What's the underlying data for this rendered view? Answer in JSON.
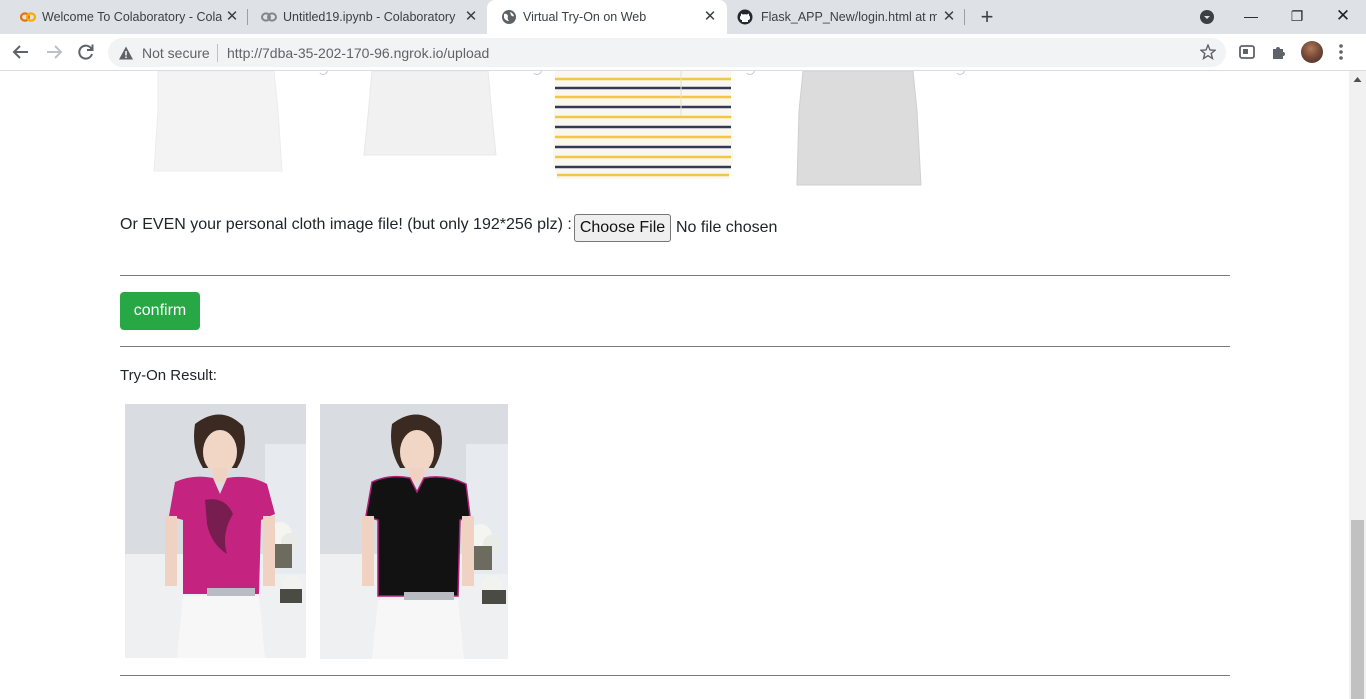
{
  "browser": {
    "tabs": [
      {
        "title": "Welcome To Colaboratory - Colab",
        "icon": "colab-icon",
        "active": false
      },
      {
        "title": "Untitled19.ipynb - Colaboratory",
        "icon": "colab-icon",
        "active": false
      },
      {
        "title": "Virtual Try-On on Web",
        "icon": "globe-icon",
        "active": true
      },
      {
        "title": "Flask_APP_New/login.html at ma",
        "icon": "github-icon",
        "active": false
      }
    ],
    "close_glyph": "✕",
    "new_tab_glyph": "+",
    "window_controls": {
      "minimize": "—",
      "restore": "❐",
      "close": "✕"
    },
    "security_label": "Not secure",
    "url": "http://7dba-35-202-170-96.ngrok.io/upload"
  },
  "page": {
    "cloth_options": [
      {
        "name": "white-tank-top",
        "color": "#f3f3f3"
      },
      {
        "name": "white-top",
        "color": "#f1f1f1"
      },
      {
        "name": "yellow-striped-shirt",
        "color": "#faf6ea"
      },
      {
        "name": "grey-tank-top",
        "color": "#dcdcdc"
      }
    ],
    "upload_label": "Or EVEN your personal cloth image file! (but only 192*256 plz) :",
    "file_button_label": "Choose File",
    "file_status": "No file chosen",
    "confirm_label": "confirm",
    "result_label": "Try-On Result:",
    "results": [
      {
        "name": "original-person",
        "shirt_color": "#c4237f"
      },
      {
        "name": "try-on-result",
        "shirt_color": "#111111"
      }
    ],
    "colors": {
      "accent": "#28a745",
      "text": "#212529",
      "rule": "#7a7a7a"
    }
  }
}
